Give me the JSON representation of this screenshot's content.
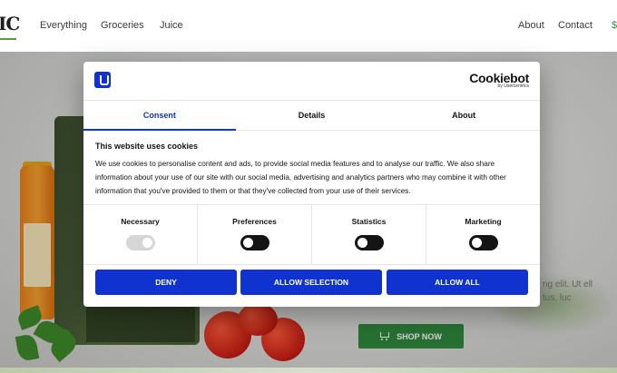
{
  "nav": {
    "logo": "IC",
    "links_left": [
      "Everything",
      "Groceries",
      "Juice"
    ],
    "links_right": [
      "About",
      "Contact"
    ],
    "cart_amount": "$"
  },
  "hero": {
    "text_line1": "ng elit. Ut ell",
    "text_line2": "tus, luc",
    "shop_button": "SHOP NOW"
  },
  "consent": {
    "brand_name": "Cookiebot",
    "brand_sub": "by Usercentrics",
    "tabs": [
      "Consent",
      "Details",
      "About"
    ],
    "active_tab": "Consent",
    "title": "This website uses cookies",
    "body": "We use cookies to personalise content and ads, to provide social media features and to analyse our traffic. We also share information about your use of our site with our social media, advertising and analytics partners who may combine it with other information that you've provided to them or that they've collected from your use of their services.",
    "toggles": [
      {
        "label": "Necessary",
        "state": "on-disabled"
      },
      {
        "label": "Preferences",
        "state": "off"
      },
      {
        "label": "Statistics",
        "state": "off"
      },
      {
        "label": "Marketing",
        "state": "off"
      }
    ],
    "buttons": {
      "deny": "DENY",
      "allow_selection": "ALLOW SELECTION",
      "allow_all": "ALLOW ALL"
    }
  },
  "colors": {
    "primary_blue": "#1032cf",
    "shop_green": "#2f8a3d"
  }
}
